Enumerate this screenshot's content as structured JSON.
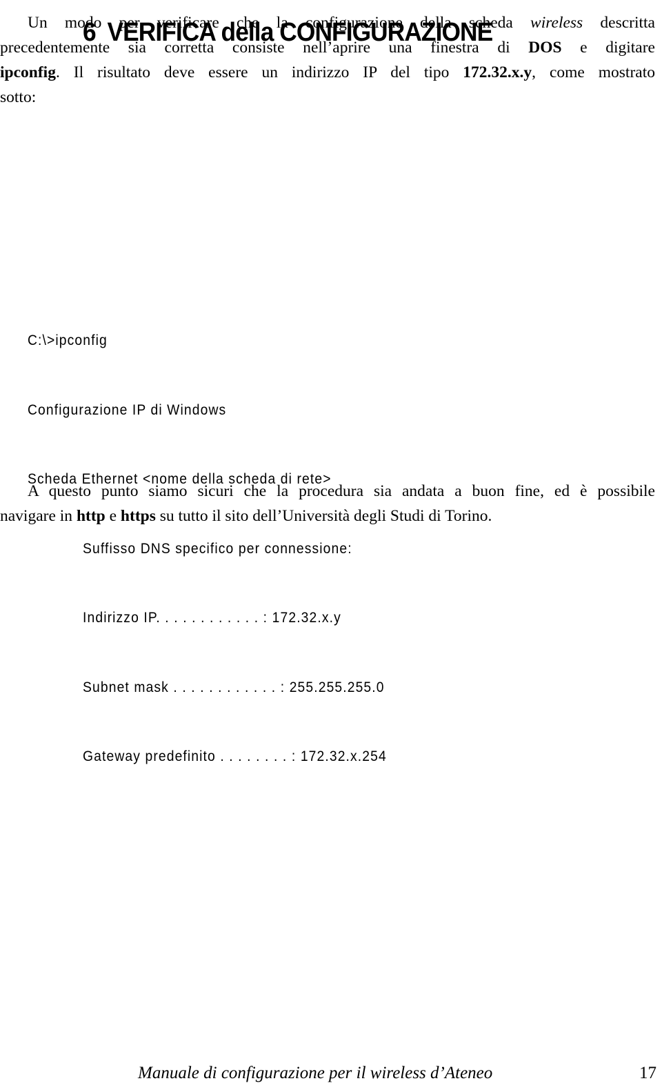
{
  "heading": {
    "number": "6",
    "title": "VERIFICA della CONFIGURAZIONE"
  },
  "intro": {
    "line1_a": "Un modo per verificare che la configurazione della scheda ",
    "line1_italic": "wireless",
    "line1_b": " descritta",
    "line2_a": "precedentemente sia corretta consiste nell’aprire una finestra di ",
    "line2_bold": "DOS",
    "line2_b": " e digitare",
    "line3_bold1": "ipconfig",
    "line3_a": ". Il risultato deve essere un indirizzo IP del tipo ",
    "line3_bold2": "172.32.x.y",
    "line3_b": ", come mostrato",
    "line4": "sotto:"
  },
  "console": {
    "command": "C:\\>ipconfig",
    "header": "Configurazione IP di Windows",
    "adapter": "Scheda Ethernet <nome della scheda di rete>",
    "rows": [
      {
        "label": "Suffisso DNS specifico per connessione:",
        "value": ""
      },
      {
        "label": "Indirizzo IP. . . . . . . . . . . . :",
        "value": "172.32.x.y"
      },
      {
        "label": "Subnet mask . . . . . . . . . . . . :",
        "value": "255.255.255.0"
      },
      {
        "label": "Gateway predefinito . . . . . . . . :",
        "value": "172.32.x.254"
      }
    ]
  },
  "conclusion": {
    "line1": "A questo punto siamo sicuri che la procedura sia andata a buon fine, ed è possibile",
    "line2_a": "navigare in ",
    "line2_bold1": "http",
    "line2_b": " e ",
    "line2_bold2": "https",
    "line2_c": " su tutto il sito dell’Università degli Studi di Torino."
  },
  "footer": {
    "title": "Manuale di configurazione per il wireless d’Ateneo",
    "page_number": "17"
  }
}
